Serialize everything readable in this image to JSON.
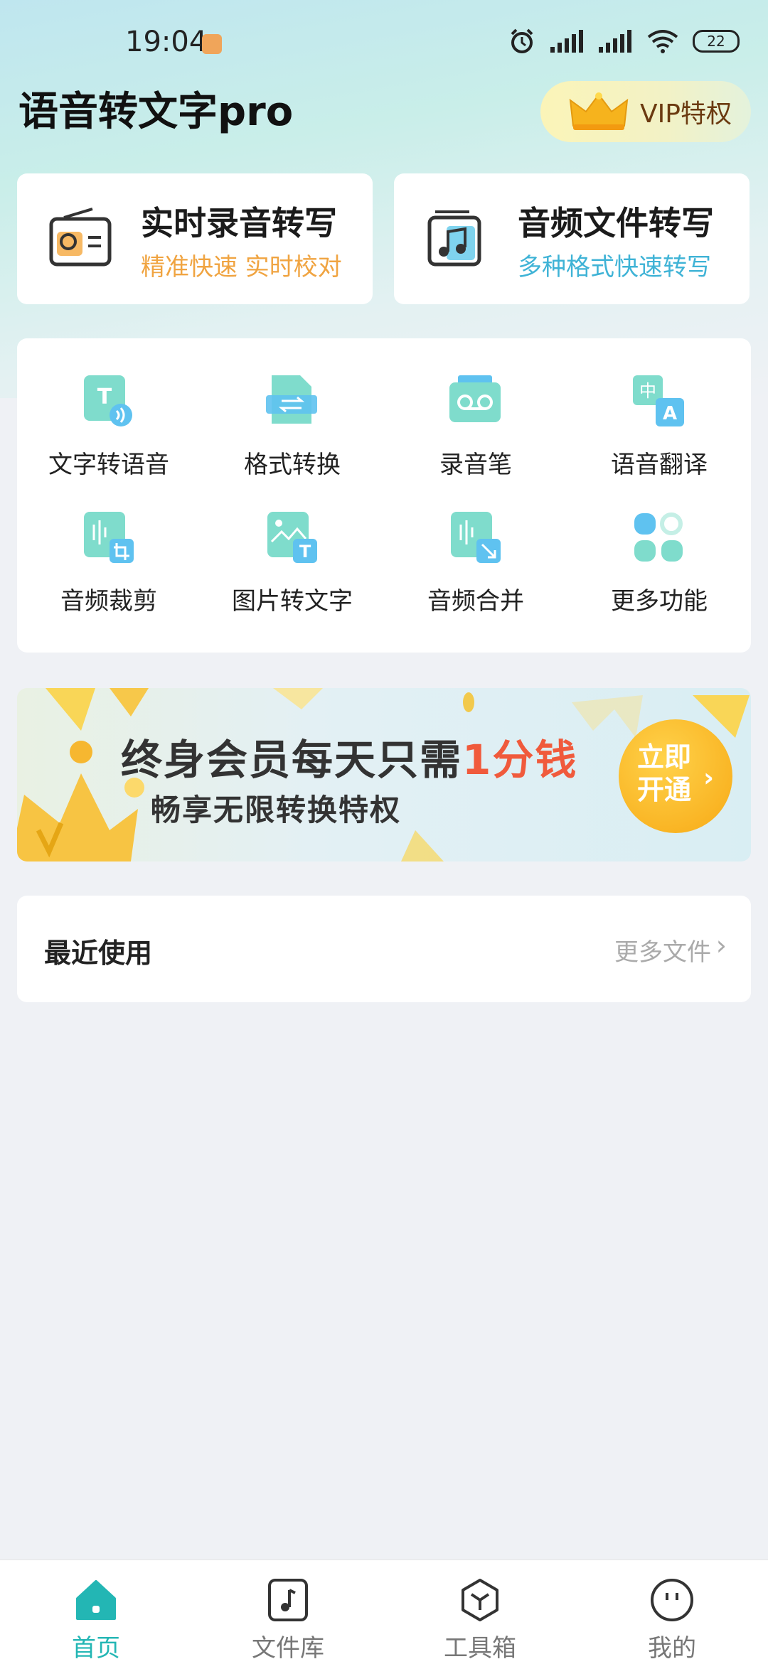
{
  "status_bar": {
    "time": "19:04",
    "battery": "22"
  },
  "header": {
    "title": "语音转文字pro",
    "vip_label": "VIP特权"
  },
  "feature_cards": [
    {
      "title": "实时录音转写",
      "subtitle": "精准快速 实时校对",
      "subtitle_color": "#f0a441",
      "icon": "radio-icon"
    },
    {
      "title": "音频文件转写",
      "subtitle": "多种格式快速转写",
      "subtitle_color": "#3fb3d6",
      "icon": "music-file-icon"
    }
  ],
  "tools": [
    {
      "label": "文字转语音",
      "icon": "text-to-speech-icon"
    },
    {
      "label": "格式转换",
      "icon": "format-convert-icon"
    },
    {
      "label": "录音笔",
      "icon": "recorder-icon"
    },
    {
      "label": "语音翻译",
      "icon": "translate-icon"
    },
    {
      "label": "音频裁剪",
      "icon": "audio-crop-icon"
    },
    {
      "label": "图片转文字",
      "icon": "image-to-text-icon"
    },
    {
      "label": "音频合并",
      "icon": "audio-merge-icon"
    },
    {
      "label": "更多功能",
      "icon": "more-apps-icon"
    }
  ],
  "banner": {
    "title_main": "终身会员每天只需",
    "title_highlight": "1分钱",
    "subtitle": "畅享无限转换特权",
    "button": "立即开通"
  },
  "recent": {
    "title": "最近使用",
    "more": "更多文件"
  },
  "tabs": [
    {
      "label": "首页",
      "icon": "home-icon",
      "active": true
    },
    {
      "label": "文件库",
      "icon": "file-library-icon",
      "active": false
    },
    {
      "label": "工具箱",
      "icon": "toolbox-icon",
      "active": false
    },
    {
      "label": "我的",
      "icon": "profile-icon",
      "active": false
    }
  ],
  "colors": {
    "accent": "#23b6b4",
    "icon_tile": "#7fdccc",
    "highlight": "#f05a3c"
  }
}
